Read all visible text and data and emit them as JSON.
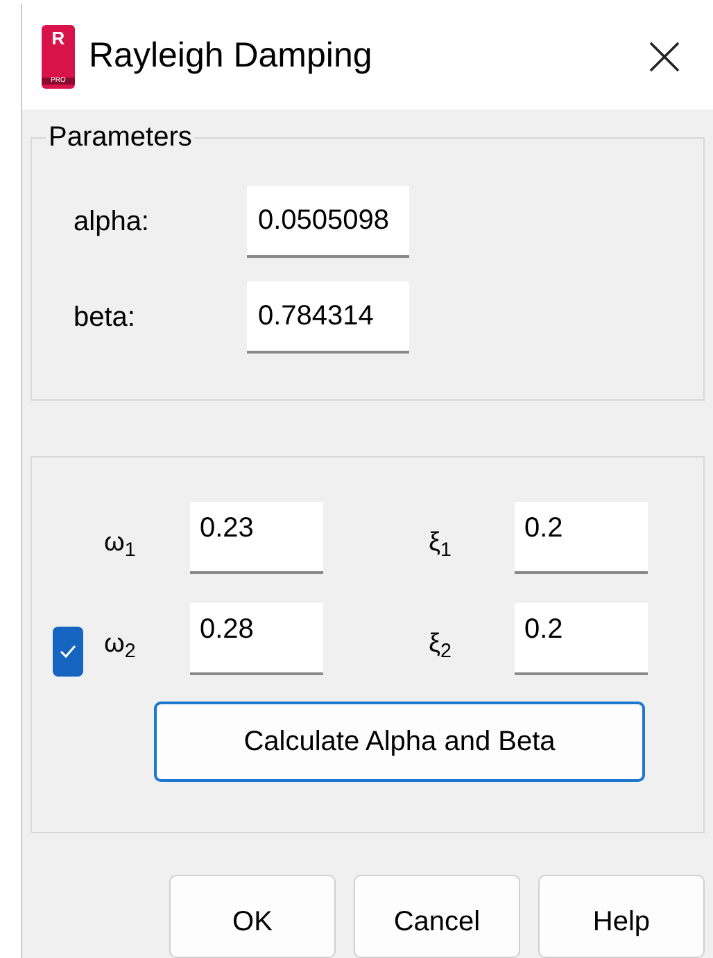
{
  "window": {
    "title": "Rayleigh Damping",
    "app_icon_letter": "R",
    "app_icon_sub": "PRO"
  },
  "parameters": {
    "title": "Parameters",
    "fields": [
      {
        "label": "alpha:",
        "value": "0.0505098"
      },
      {
        "label": "beta:",
        "value": "0.784314"
      }
    ]
  },
  "frequencies": {
    "checked": true,
    "rows": [
      [
        {
          "label": "ω$_{1}$",
          "value": "0.23"
        },
        {
          "label": "ξ$_{1}$",
          "value": "0.2"
        }
      ],
      [
        {
          "label": "ω$_{2}$",
          "value": "0.28"
        },
        {
          "label": "ξ$_{2}$",
          "value": "0.2"
        }
      ]
    ],
    "calculate_button": "Calculate Alpha and Beta"
  },
  "buttons": [
    "OK",
    "Cancel",
    "Help"
  ]
}
